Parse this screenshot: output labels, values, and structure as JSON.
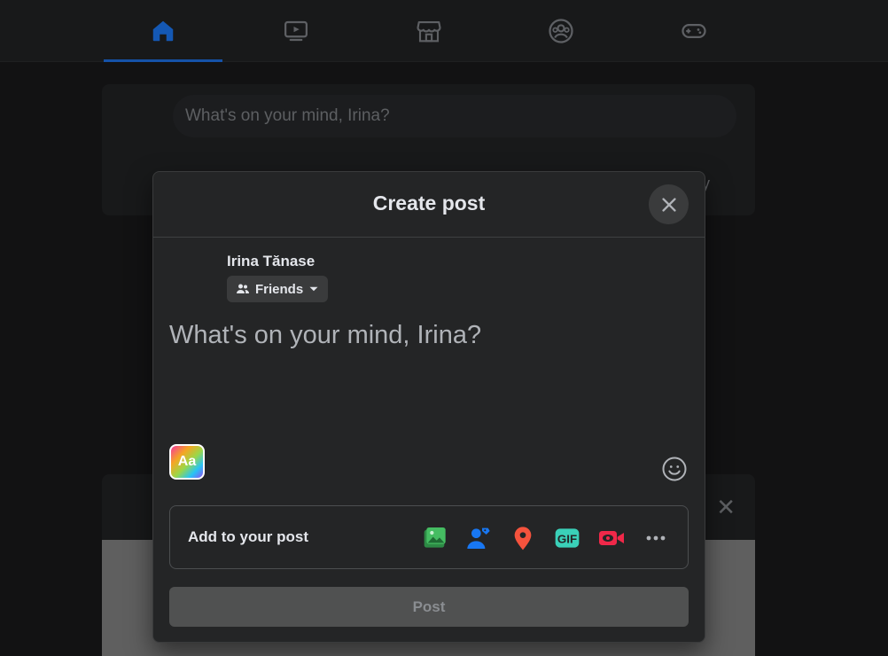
{
  "nav": {
    "tabs": [
      {
        "icon": "home-icon",
        "active": true
      },
      {
        "icon": "watch-icon",
        "active": false
      },
      {
        "icon": "marketplace-icon",
        "active": false
      },
      {
        "icon": "groups-icon",
        "active": false
      },
      {
        "icon": "gaming-icon",
        "active": false
      }
    ]
  },
  "background": {
    "composer_placeholder": "What's on your mind, Irina?",
    "partial_text": "y",
    "close_glyph": "✕"
  },
  "dialog": {
    "title": "Create post",
    "author_name": "Irina Tănase",
    "audience_label": "Friends",
    "composer_placeholder": "What's on your mind, Irina?",
    "aa_label": "Aa",
    "add_to_post_label": "Add to your post",
    "add_icons": [
      "photo-video-icon",
      "tag-people-icon",
      "check-in-icon",
      "gif-icon",
      "live-video-icon",
      "more-icon"
    ],
    "post_button_label": "Post"
  },
  "colors": {
    "accent": "#1877f2",
    "photo_green": "#45bd62",
    "tag_blue": "#1877f2",
    "location_red": "#f5533d",
    "gif_teal": "#3ad0b8",
    "live_red": "#f02849"
  }
}
